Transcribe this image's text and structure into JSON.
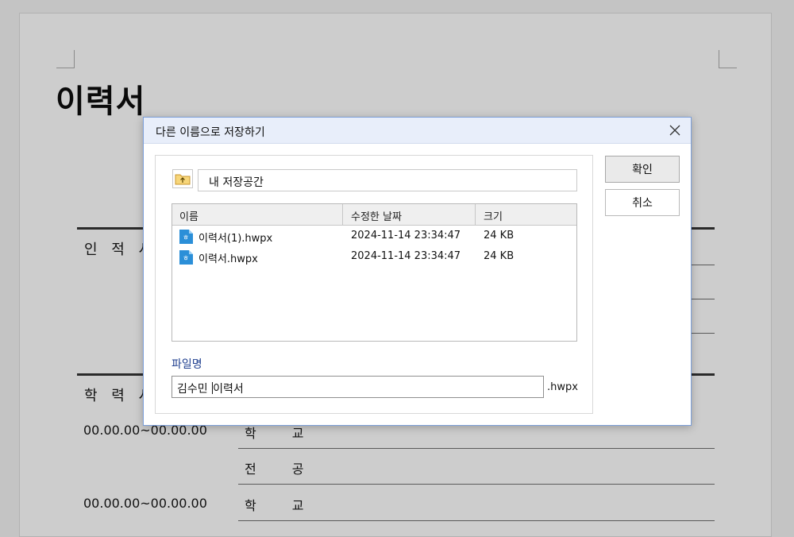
{
  "document": {
    "title": "이력서",
    "section_personal": "인 적 사",
    "section_education": "학 력 사",
    "date_range_1": "00.00.00~00.00.00",
    "date_range_2": "00.00.00~00.00.00",
    "field_school_1": "학 교",
    "field_major": "전 공",
    "field_school_2": "학 교"
  },
  "dialog": {
    "title": "다른 이름으로 저장하기",
    "path": "내 저장공간",
    "columns": {
      "name": "이름",
      "modified": "수정한 날짜",
      "size": "크기"
    },
    "files": [
      {
        "name": "이력서(1).hwpx",
        "modified": "2024-11-14 23:34:47",
        "size": "24 KB"
      },
      {
        "name": "이력서.hwpx",
        "modified": "2024-11-14 23:34:47",
        "size": "24 KB"
      }
    ],
    "filename_label": "파일명",
    "filename_before_caret": "김수민 ",
    "filename_after_caret": "이력서",
    "extension": ".hwpx",
    "ok_label": "확인",
    "cancel_label": "취소"
  },
  "icons": {
    "close": "close-icon",
    "folder_up": "folder-up-icon",
    "file": "hwp-file-icon"
  },
  "colors": {
    "dialog_border": "#7b9ed8",
    "titlebar": "#e8eefa",
    "file_icon": "#2b8fd8",
    "label_blue": "#1f3f8f"
  }
}
